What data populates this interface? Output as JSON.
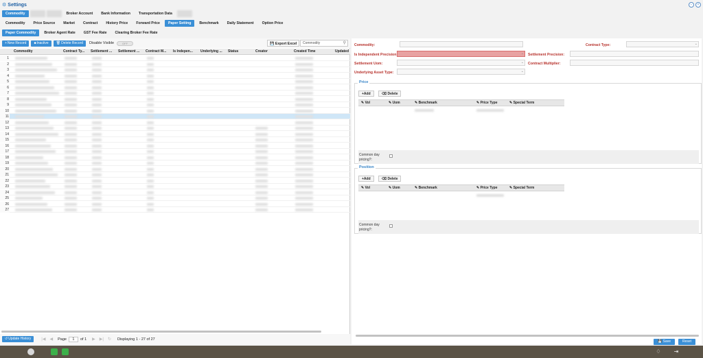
{
  "window": {
    "title": "Settings"
  },
  "top_tabs": [
    {
      "label": "Commodity",
      "active": true,
      "blurred": false
    },
    {
      "label": "",
      "active": false,
      "blurred": true
    },
    {
      "label": "",
      "active": false,
      "blurred": true
    },
    {
      "label": "Broker Account",
      "active": false,
      "blurred": false
    },
    {
      "label": "Bank Information",
      "active": false,
      "blurred": false
    },
    {
      "label": "Transportation Data",
      "active": false,
      "blurred": false
    },
    {
      "label": "",
      "active": false,
      "blurred": true
    }
  ],
  "sub_tabs": [
    {
      "label": "Commodity",
      "active": false
    },
    {
      "label": "Price Source",
      "active": false
    },
    {
      "label": "Market",
      "active": false
    },
    {
      "label": "Contract",
      "active": false
    },
    {
      "label": "History Price",
      "active": false
    },
    {
      "label": "Forward Price",
      "active": false
    },
    {
      "label": "Paper Setting",
      "active": true
    },
    {
      "label": "Benchmark",
      "active": false
    },
    {
      "label": "Daily Statement",
      "active": false
    },
    {
      "label": "Option Price",
      "active": false
    }
  ],
  "third_tabs": [
    {
      "label": "Paper Commodity",
      "active": true
    },
    {
      "label": "Broker Agent Rate",
      "active": false
    },
    {
      "label": "GST Fee Rate",
      "active": false
    },
    {
      "label": "Clearing Broker Fee Rate",
      "active": false
    }
  ],
  "toolbar": {
    "new_record": "New Record",
    "inactive": "Inactive",
    "delete_record": "Delete Record",
    "disable_visible": "Disable Visible",
    "toggle_text": "OFF",
    "export_excel": "Export Excel",
    "search_placeholder": "Commodity"
  },
  "grid": {
    "columns": [
      "Commodity",
      "Contract Ty...",
      "Settlement ...",
      "Settlement ...",
      "Contract M...",
      "Is Indepen...",
      "Underlying ...",
      "Status",
      "Creator",
      "Created Time",
      "Updated"
    ],
    "row_count": 27,
    "selected_row": 11
  },
  "pager": {
    "update_history": "Update History",
    "page_label": "Page",
    "page_value": "1",
    "of_label": "of 1",
    "display_text": "Displaying 1 - 27 of 27"
  },
  "form": {
    "commodity": "Commodity:",
    "contract_type": "Contract Type:",
    "is_independent_precision": "Is Independent Precision:",
    "settlement_precision": "Settlement Precision:",
    "settlement_uom": "Settlement Uom:",
    "contract_multiplier": "Contract Multiplier:",
    "underlying_asset_type": "Underlying Asset Type:"
  },
  "price_section": {
    "title": "Price",
    "add": "Add",
    "delete": "Delete",
    "columns": [
      "Vol",
      "Uom",
      "Benchmark",
      "Price Type",
      "Special Term"
    ],
    "common_day_pricing": "Common day pricing?:"
  },
  "position_section": {
    "title": "Position",
    "add": "Add",
    "delete": "Delete",
    "columns": [
      "Vol",
      "Uom",
      "Benchmark",
      "Price Type",
      "Special Term"
    ],
    "common_day_pricing": "Common day pricing?:"
  },
  "footer": {
    "save": "Save",
    "reset": "Reset"
  },
  "colors": {
    "accent": "#3a8fd6",
    "error_label": "#b7322c",
    "selected_row": "#cfe6f7",
    "taskbar": "#5b5346"
  }
}
